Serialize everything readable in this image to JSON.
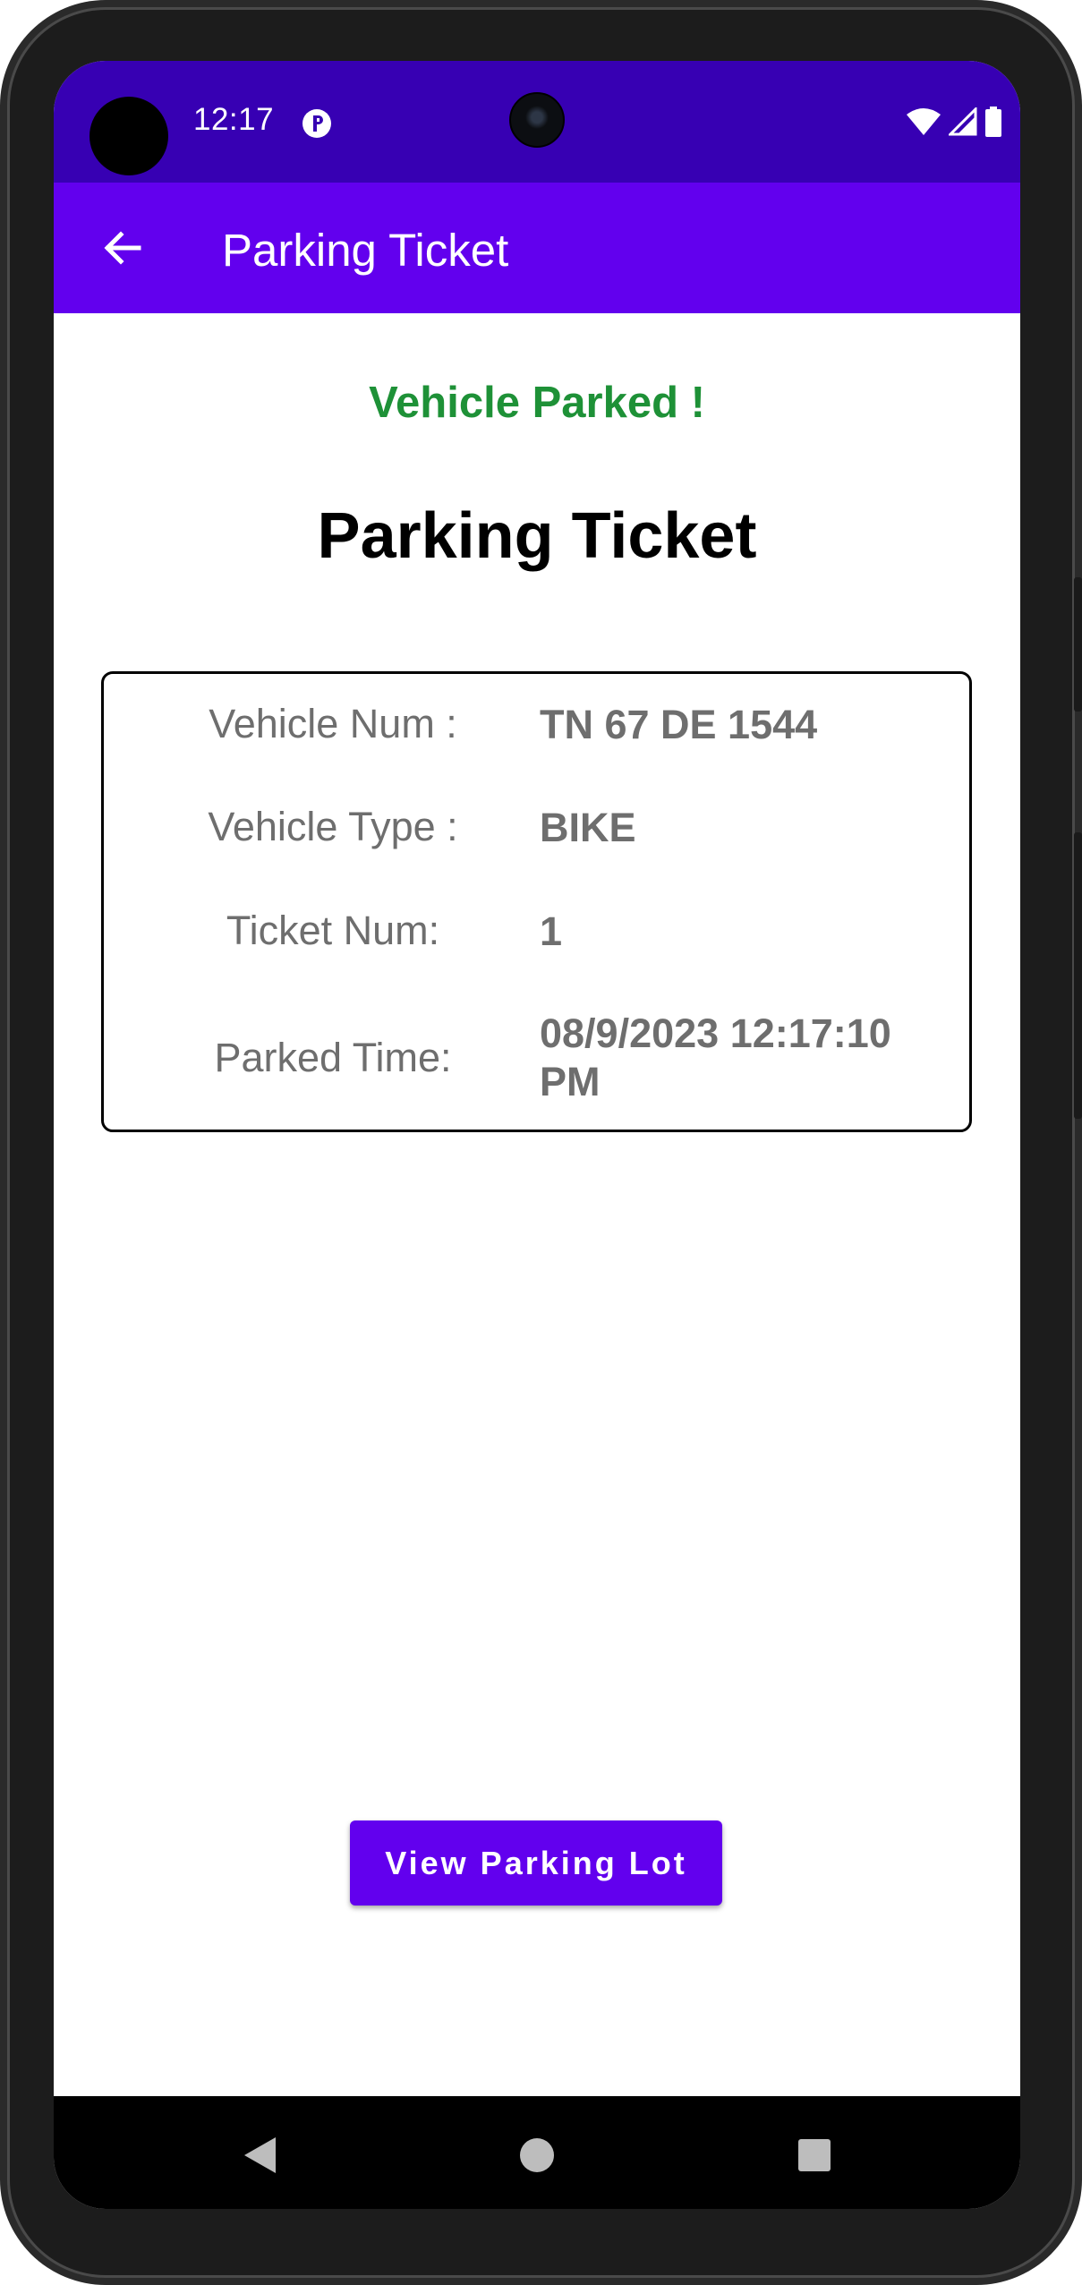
{
  "status_bar": {
    "time": "12:17",
    "icons": [
      "notification-p-icon",
      "wifi-icon",
      "cell-signal-icon",
      "battery-icon"
    ]
  },
  "app_bar": {
    "back_icon": "arrow-back-icon",
    "title": "Parking Ticket"
  },
  "content": {
    "success_message": "Vehicle Parked !",
    "heading": "Parking Ticket",
    "ticket": {
      "vehicle_num_label": "Vehicle Num :",
      "vehicle_num_value": "TN 67 DE 1544",
      "vehicle_type_label": "Vehicle Type :",
      "vehicle_type_value": "BIKE",
      "ticket_num_label": "Ticket Num:",
      "ticket_num_value": "1",
      "parked_time_label": "Parked Time:",
      "parked_time_value": "08/9/2023 12:17:10 PM"
    },
    "view_lot_button": "View Parking Lot"
  },
  "nav_bar": {
    "icons": [
      "back-triangle-icon",
      "home-circle-icon",
      "recents-square-icon"
    ]
  },
  "colors": {
    "status_bar": "#3700B3",
    "app_bar": "#6200EE",
    "success": "#1E9137",
    "secondary_text": "#6e6e6e",
    "button": "#6200EE"
  }
}
